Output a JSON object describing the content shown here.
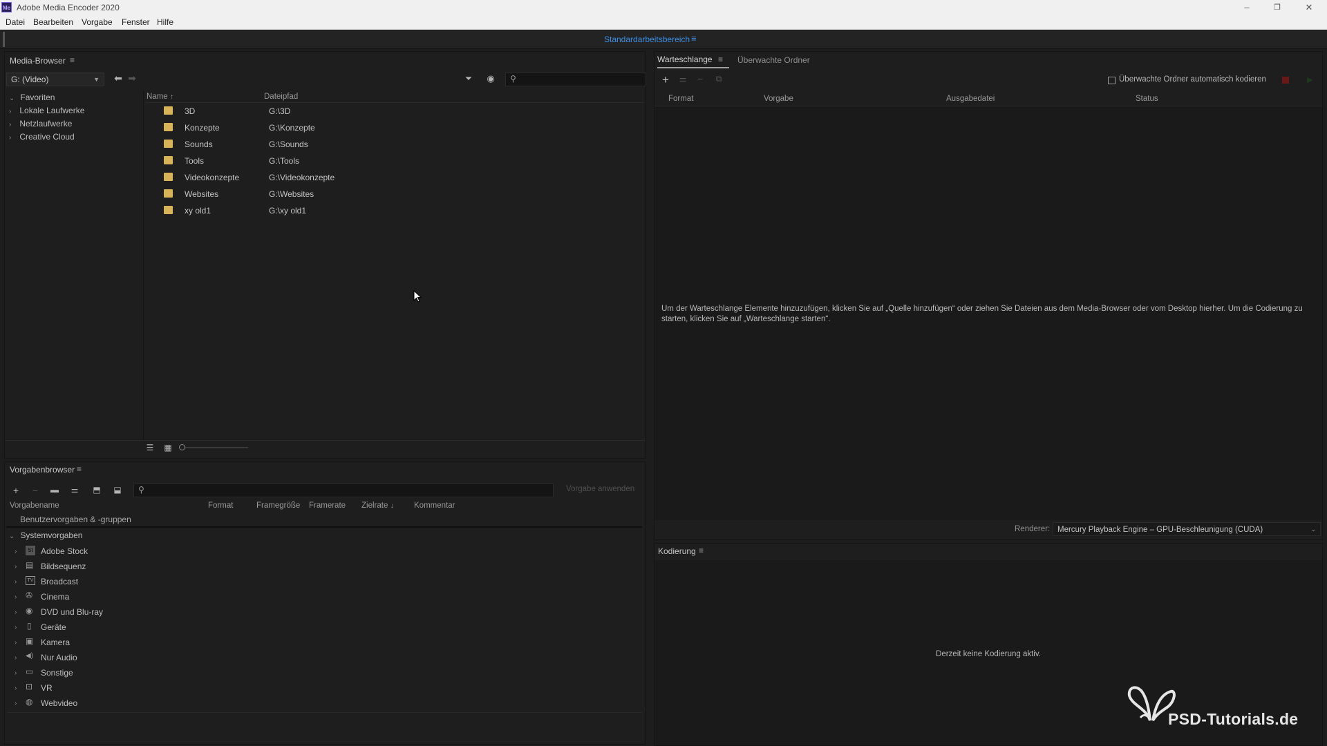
{
  "window": {
    "title": "Adobe Media Encoder 2020",
    "app_badge": "Me",
    "minimize_glyph": "–",
    "restore_glyph": "❐",
    "close_glyph": "✕"
  },
  "menu": [
    "Datei",
    "Bearbeiten",
    "Vorgabe",
    "Fenster",
    "Hilfe"
  ],
  "workspace": {
    "name": "Standardarbeitsbereich"
  },
  "media_browser": {
    "title": "Media-Browser",
    "drive": "G: (Video)",
    "tree": [
      "Favoriten",
      "Lokale Laufwerke",
      "Netzlaufwerke",
      "Creative Cloud"
    ],
    "columns": {
      "name": "Name",
      "path": "Dateipfad"
    },
    "rows": [
      {
        "name": "3D",
        "path": "G:\\3D"
      },
      {
        "name": "Konzepte",
        "path": "G:\\Konzepte"
      },
      {
        "name": "Sounds",
        "path": "G:\\Sounds"
      },
      {
        "name": "Tools",
        "path": "G:\\Tools"
      },
      {
        "name": "Videokonzepte",
        "path": "G:\\Videokonzepte"
      },
      {
        "name": "Websites",
        "path": "G:\\Websites"
      },
      {
        "name": "xy old1",
        "path": "G:\\xy old1"
      }
    ]
  },
  "queue": {
    "tabs": [
      "Warteschlange",
      "Überwachte Ordner"
    ],
    "auto_encode_label": "Überwachte Ordner automatisch kodieren",
    "columns": [
      "Format",
      "Vorgabe",
      "Ausgabedatei",
      "Status"
    ],
    "hint": "Um der Warteschlange Elemente hinzuzufügen, klicken Sie auf „Quelle hinzufügen“ oder ziehen Sie Dateien aus dem Media-Browser oder vom Desktop hierher. Um die Codierung zu starten, klicken Sie auf „Warteschlange starten“.",
    "renderer_label": "Renderer:",
    "renderer_value": "Mercury Playback Engine – GPU-Beschleunigung (CUDA)"
  },
  "preset_browser": {
    "title": "Vorgabenbrowser",
    "apply_button": "Vorgabe anwenden",
    "columns": [
      "Vorgabename",
      "Format",
      "Framegröße",
      "Framerate",
      "Zielrate",
      "Kommentar"
    ],
    "user_group": "Benutzervorgaben & -gruppen",
    "system_group": "Systemvorgaben",
    "items": [
      {
        "label": "Adobe Stock",
        "icon": "St"
      },
      {
        "label": "Bildsequenz",
        "icon": "▤"
      },
      {
        "label": "Broadcast",
        "icon": "TV"
      },
      {
        "label": "Cinema",
        "icon": "✇"
      },
      {
        "label": "DVD und Blu-ray",
        "icon": "◉"
      },
      {
        "label": "Geräte",
        "icon": "▯"
      },
      {
        "label": "Kamera",
        "icon": "▣"
      },
      {
        "label": "Nur Audio",
        "icon": "◀)"
      },
      {
        "label": "Sonstige",
        "icon": "▭"
      },
      {
        "label": "VR",
        "icon": "⊡"
      },
      {
        "label": "Webvideo",
        "icon": "◍"
      }
    ]
  },
  "encoding": {
    "title": "Kodierung",
    "status": "Derzeit keine Kodierung aktiv."
  },
  "watermark": {
    "text": "PSD-Tutorials.de"
  },
  "colors": {
    "accent": "#3c8fe6",
    "folder": "#d7b35a",
    "stop_button": "#8a1f1f"
  }
}
